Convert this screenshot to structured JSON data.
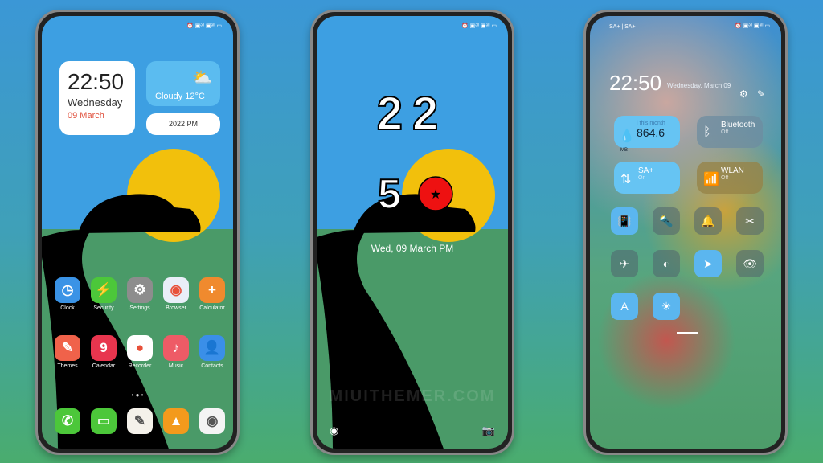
{
  "home": {
    "status": "⏰ ▣ᵊˡˡ ▣ᵊˡˡ ▭",
    "clock_time": "22:50",
    "clock_day": "Wednesday",
    "clock_date": "09 March",
    "weather": "Cloudy  12°C",
    "year_pill": "2022 PM",
    "apps": [
      {
        "label": "Clock",
        "glyph": "◷",
        "color": "#3a93e6"
      },
      {
        "label": "Security",
        "glyph": "⚡",
        "color": "#4cc73a"
      },
      {
        "label": "Settings",
        "glyph": "⚙",
        "color": "#8d8d8d"
      },
      {
        "label": "Browser",
        "glyph": "◉",
        "color": "#e9eef8"
      },
      {
        "label": "Calculator",
        "glyph": "+",
        "color": "#f08a2e"
      },
      {
        "label": "Themes",
        "glyph": "✎",
        "color": "#f0624a"
      },
      {
        "label": "Calendar",
        "glyph": "9",
        "color": "#e8354e"
      },
      {
        "label": "Recorder",
        "glyph": "●",
        "color": "#ffffff"
      },
      {
        "label": "Music",
        "glyph": "♪",
        "color": "#ee5b66"
      },
      {
        "label": "Contacts",
        "glyph": "👤",
        "color": "#3a8fe8"
      }
    ],
    "dock": [
      {
        "name": "phone",
        "glyph": "✆",
        "color": "#4cc73a"
      },
      {
        "name": "messages",
        "glyph": "▭",
        "color": "#4cc73a"
      },
      {
        "name": "notes",
        "glyph": "✎",
        "color": "#f4f1ea"
      },
      {
        "name": "gallery",
        "glyph": "▲",
        "color": "#f39a1c"
      },
      {
        "name": "camera",
        "glyph": "◉",
        "color": "#f4f4f4"
      }
    ]
  },
  "lock": {
    "status": "⏰ ▣ᵊˡˡ ▣ᵊˡˡ ▭",
    "hour": "22",
    "minute": "5",
    "date": "Wed, 09 March PM",
    "watermark": "MIUITHEMER.COM"
  },
  "control": {
    "carrier": "SA+ | SA+",
    "status": "⏰ ▣ᵊˡˡ ▣ᵊˡˡ ▭",
    "time": "22:50",
    "date": "Wednesday, March 09",
    "data_label": "l this month",
    "data_value": "864.6",
    "data_unit": "MB",
    "bluetooth": {
      "label": "Bluetooth",
      "state": "Off"
    },
    "sim": {
      "label": "SA+",
      "state": "On"
    },
    "wlan": {
      "label": "WLAN",
      "state": "Off"
    },
    "toggles": [
      {
        "name": "vibrate",
        "glyph": "📳",
        "on": true
      },
      {
        "name": "flashlight",
        "glyph": "🔦",
        "on": false
      },
      {
        "name": "mute",
        "glyph": "🔔",
        "on": false
      },
      {
        "name": "screenshot",
        "glyph": "✂",
        "on": false
      },
      {
        "name": "airplane",
        "glyph": "✈",
        "on": false
      },
      {
        "name": "dark-mode",
        "glyph": "◐",
        "on": false
      },
      {
        "name": "location",
        "glyph": "➤",
        "on": true
      },
      {
        "name": "reading-mode",
        "glyph": "👁",
        "on": false
      },
      {
        "name": "auto-brightness",
        "glyph": "A",
        "on": true
      },
      {
        "name": "brightness",
        "glyph": "☀",
        "on": true
      }
    ]
  }
}
